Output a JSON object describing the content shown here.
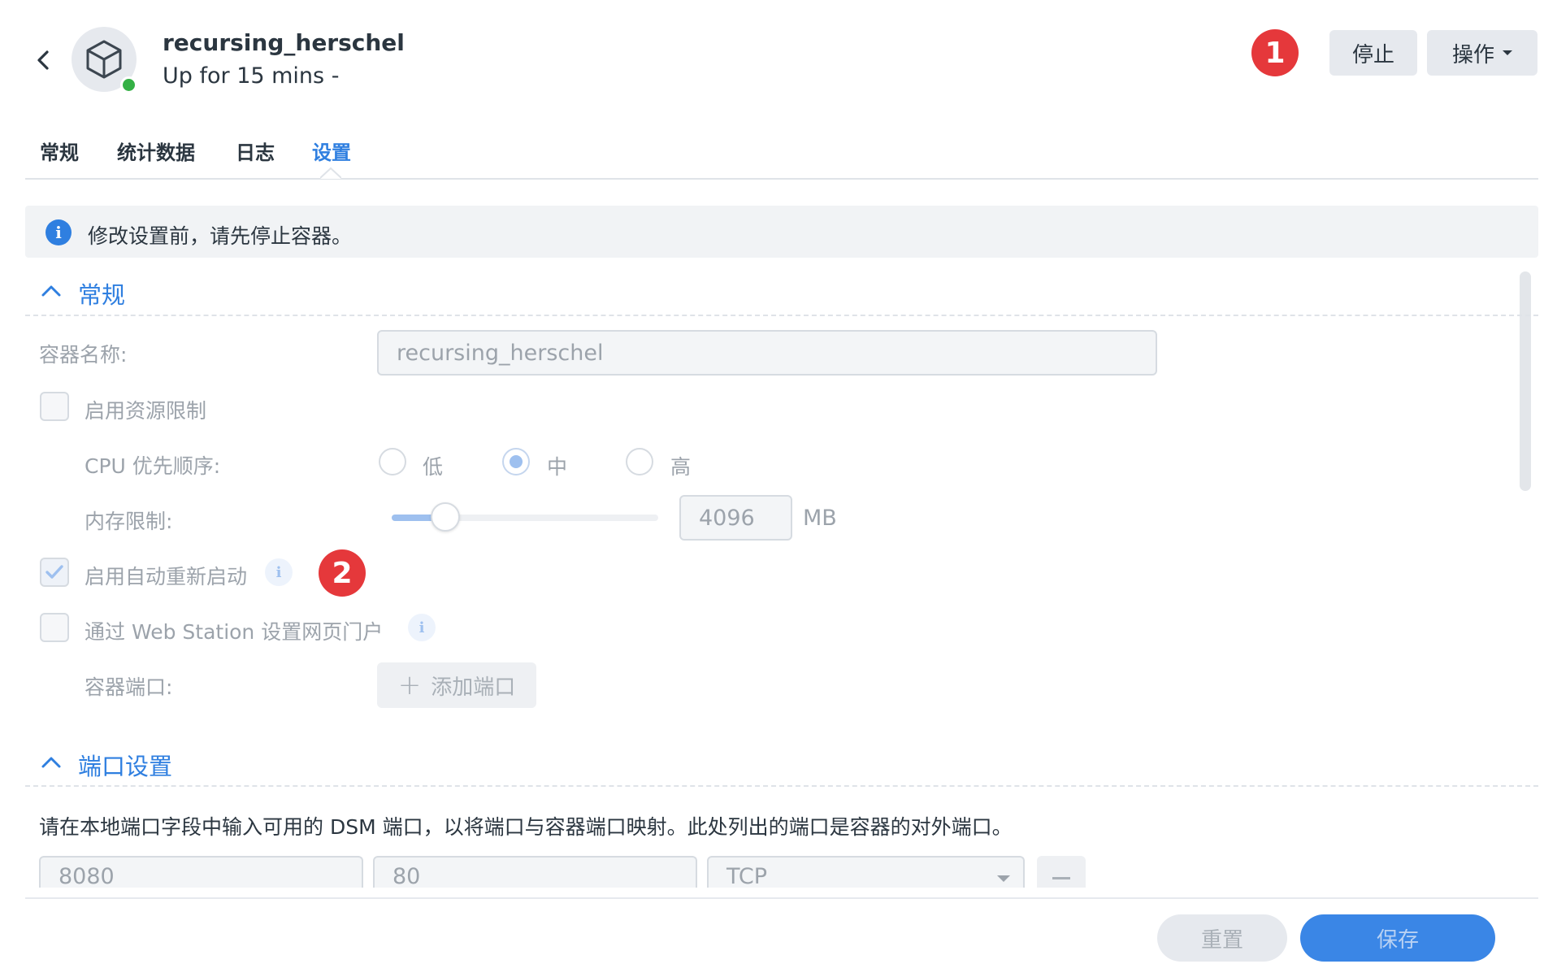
{
  "header": {
    "title": "recursing_herschel",
    "subtitle": "Up for 15 mins -",
    "stop_label": "停止",
    "actions_label": "操作",
    "status_color": "#34b045"
  },
  "annotations": {
    "badge1": "1",
    "badge2": "2"
  },
  "tabs": [
    {
      "label": "常规",
      "active": false
    },
    {
      "label": "统计数据",
      "active": false
    },
    {
      "label": "日志",
      "active": false
    },
    {
      "label": "设置",
      "active": true
    }
  ],
  "banner": {
    "icon": "info-icon",
    "text": "修改设置前，请先停止容器。"
  },
  "general": {
    "title": "常规",
    "container_name_label": "容器名称:",
    "container_name_value": "recursing_herschel",
    "resource_limit_label": "启用资源限制",
    "resource_limit_checked": false,
    "cpu_priority_label": "CPU 优先顺序:",
    "cpu_options": [
      "低",
      "中",
      "高"
    ],
    "cpu_selected": "中",
    "memory_limit_label": "内存限制:",
    "memory_value": "4096",
    "memory_unit": "MB",
    "memory_slider_fraction": 0.2,
    "auto_restart_label": "启用自动重新启动",
    "auto_restart_checked": true,
    "web_station_label": "通过 Web Station 设置网页门户",
    "web_station_checked": false,
    "container_port_label": "容器端口:",
    "add_port_label": "添加端口"
  },
  "port_settings": {
    "title": "端口设置",
    "description": "请在本地端口字段中输入可用的 DSM 端口，以将端口与容器端口映射。此处列出的端口是容器的对外端口。",
    "rows": [
      {
        "local_port": "8080",
        "container_port": "80",
        "protocol": "TCP"
      }
    ]
  },
  "footer": {
    "reset_label": "重置",
    "save_label": "保存"
  },
  "colors": {
    "accent": "#2f7fe0",
    "danger": "#e5383b",
    "save": "#3a86e6"
  }
}
